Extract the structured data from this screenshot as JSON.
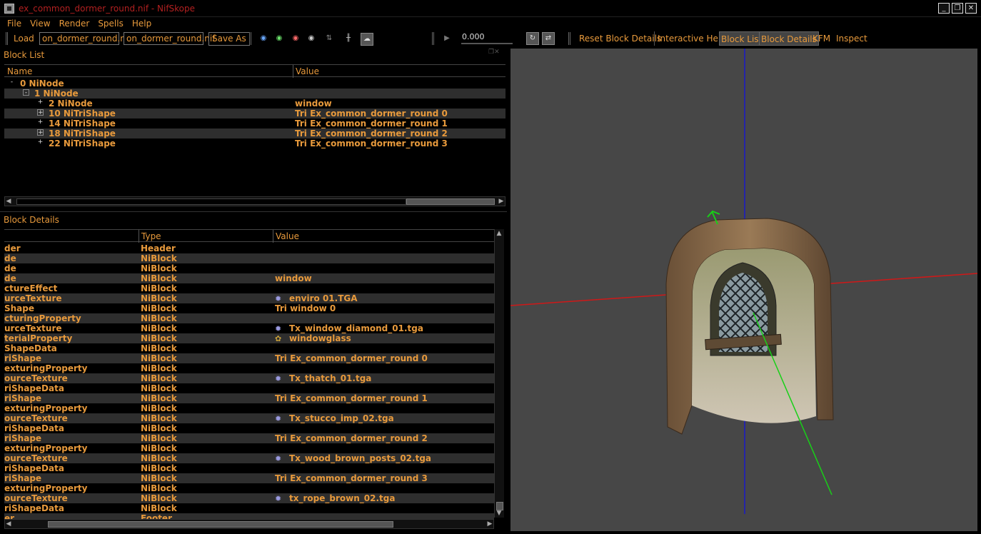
{
  "window": {
    "title": "ex_common_dormer_round.nif - NifSkope",
    "min_icon": "minimize-icon",
    "max_icon": "restore-icon",
    "close_icon": "close-icon"
  },
  "menu": [
    "File",
    "View",
    "Render",
    "Spells",
    "Help"
  ],
  "toolbar": {
    "load": "Load",
    "file1": "on_dormer_round.nif",
    "file2": "on_dormer_round.nif",
    "save_as": "Save As",
    "time_value": "0.000",
    "reset_block_details": "Reset Block Details",
    "interactive_help": "Interactive Help",
    "block_list": "Block List",
    "block_details": "Block Details",
    "kfm": "KFM",
    "inspect": "Inspect"
  },
  "block_list": {
    "title": "Block List",
    "col_name": "Name",
    "col_value": "Value",
    "rows": [
      {
        "name": "0 NiNode",
        "value": "",
        "expander": "-",
        "indent": 0
      },
      {
        "name": "1 NiNode",
        "value": "",
        "expander": "-",
        "indent": 1
      },
      {
        "name": "2 NiNode",
        "value": "window",
        "expander": "+",
        "indent": 2
      },
      {
        "name": "10 NiTriShape",
        "value": "Tri Ex_common_dormer_round 0",
        "expander": "+",
        "indent": 2
      },
      {
        "name": "14 NiTriShape",
        "value": "Tri Ex_common_dormer_round 1",
        "expander": "+",
        "indent": 2
      },
      {
        "name": "18 NiTriShape",
        "value": "Tri Ex_common_dormer_round 2",
        "expander": "+",
        "indent": 2
      },
      {
        "name": "22 NiTriShape",
        "value": "Tri Ex_common_dormer_round 3",
        "expander": "+",
        "indent": 2
      }
    ]
  },
  "block_details": {
    "title": "Block Details",
    "col_type": "Type",
    "col_value": "Value",
    "rows": [
      {
        "name": "der",
        "type": "Header",
        "value": "",
        "icon": ""
      },
      {
        "name": "de",
        "type": "NiBlock",
        "value": "",
        "icon": ""
      },
      {
        "name": "de",
        "type": "NiBlock",
        "value": "",
        "icon": ""
      },
      {
        "name": "de",
        "type": "NiBlock",
        "value": "window",
        "icon": ""
      },
      {
        "name": "ctureEffect",
        "type": "NiBlock",
        "value": "",
        "icon": ""
      },
      {
        "name": "urceTexture",
        "type": "NiBlock",
        "value": "enviro 01.TGA",
        "icon": "texture"
      },
      {
        "name": "Shape",
        "type": "NiBlock",
        "value": "Tri window 0",
        "icon": ""
      },
      {
        "name": "cturingProperty",
        "type": "NiBlock",
        "value": "",
        "icon": ""
      },
      {
        "name": "urceTexture",
        "type": "NiBlock",
        "value": "Tx_window_diamond_01.tga",
        "icon": "texture"
      },
      {
        "name": "terialProperty",
        "type": "NiBlock",
        "value": "windowglass",
        "icon": "material"
      },
      {
        "name": "ShapeData",
        "type": "NiBlock",
        "value": "",
        "icon": ""
      },
      {
        "name": "riShape",
        "type": "NiBlock",
        "value": "Tri Ex_common_dormer_round 0",
        "icon": ""
      },
      {
        "name": "exturingProperty",
        "type": "NiBlock",
        "value": "",
        "icon": ""
      },
      {
        "name": "ourceTexture",
        "type": "NiBlock",
        "value": "Tx_thatch_01.tga",
        "icon": "texture"
      },
      {
        "name": "riShapeData",
        "type": "NiBlock",
        "value": "",
        "icon": ""
      },
      {
        "name": "riShape",
        "type": "NiBlock",
        "value": "Tri Ex_common_dormer_round 1",
        "icon": ""
      },
      {
        "name": "exturingProperty",
        "type": "NiBlock",
        "value": "",
        "icon": ""
      },
      {
        "name": "ourceTexture",
        "type": "NiBlock",
        "value": "Tx_stucco_imp_02.tga",
        "icon": "texture"
      },
      {
        "name": "riShapeData",
        "type": "NiBlock",
        "value": "",
        "icon": ""
      },
      {
        "name": "riShape",
        "type": "NiBlock",
        "value": "Tri Ex_common_dormer_round 2",
        "icon": ""
      },
      {
        "name": "exturingProperty",
        "type": "NiBlock",
        "value": "",
        "icon": ""
      },
      {
        "name": "ourceTexture",
        "type": "NiBlock",
        "value": "Tx_wood_brown_posts_02.tga",
        "icon": "texture"
      },
      {
        "name": "riShapeData",
        "type": "NiBlock",
        "value": "",
        "icon": ""
      },
      {
        "name": "riShape",
        "type": "NiBlock",
        "value": "Tri Ex_common_dormer_round 3",
        "icon": ""
      },
      {
        "name": "exturingProperty",
        "type": "NiBlock",
        "value": "",
        "icon": ""
      },
      {
        "name": "ourceTexture",
        "type": "NiBlock",
        "value": "tx_rope_brown_02.tga",
        "icon": "texture"
      },
      {
        "name": "riShapeData",
        "type": "NiBlock",
        "value": "",
        "icon": ""
      },
      {
        "name": "er",
        "type": "Footer",
        "value": "",
        "icon": ""
      }
    ]
  },
  "colors": {
    "accent": "#e89a3c",
    "title_red": "#b22020",
    "viewport_bg": "#474747",
    "axis_x": "#d01818",
    "axis_y": "#18d018",
    "axis_z": "#1818c8"
  }
}
